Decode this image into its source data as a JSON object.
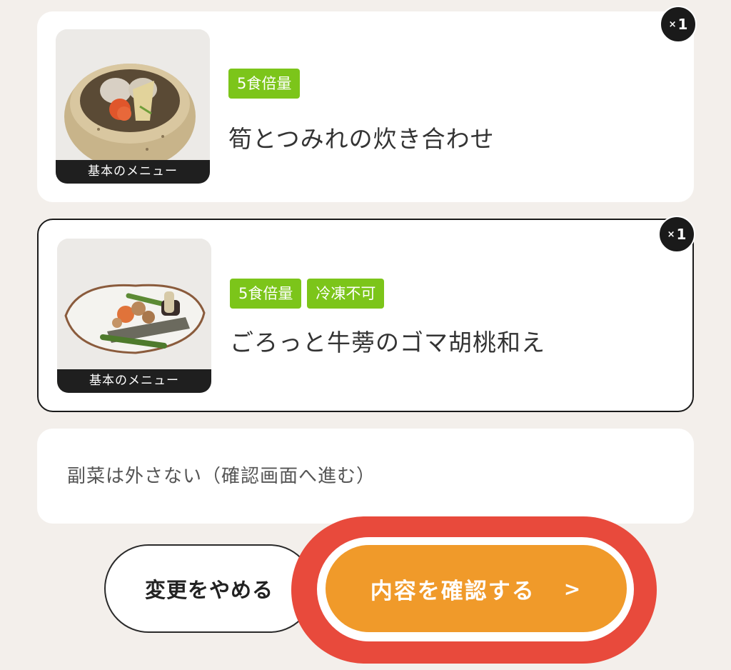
{
  "items": [
    {
      "thumb_label": "基本のメニュー",
      "tags": [
        "5食倍量"
      ],
      "title": "筍とつみれの炊き合わせ",
      "quantity": "1",
      "selected": false
    },
    {
      "thumb_label": "基本のメニュー",
      "tags": [
        "5食倍量",
        "冷凍不可"
      ],
      "title": "ごろっと牛蒡のゴマ胡桃和え",
      "quantity": "1",
      "selected": true
    }
  ],
  "quantity_prefix": "×",
  "option": {
    "label": "副菜は外さない（確認画面へ進む）"
  },
  "buttons": {
    "cancel_label": "変更をやめる",
    "confirm_label": "内容を確認する",
    "confirm_chevron": ">"
  },
  "colors": {
    "background": "#f3efeb",
    "tag": "#7cc51a",
    "confirm": "#f09a2a",
    "highlight": "#e84a3c",
    "badge": "#1a1a1a"
  }
}
